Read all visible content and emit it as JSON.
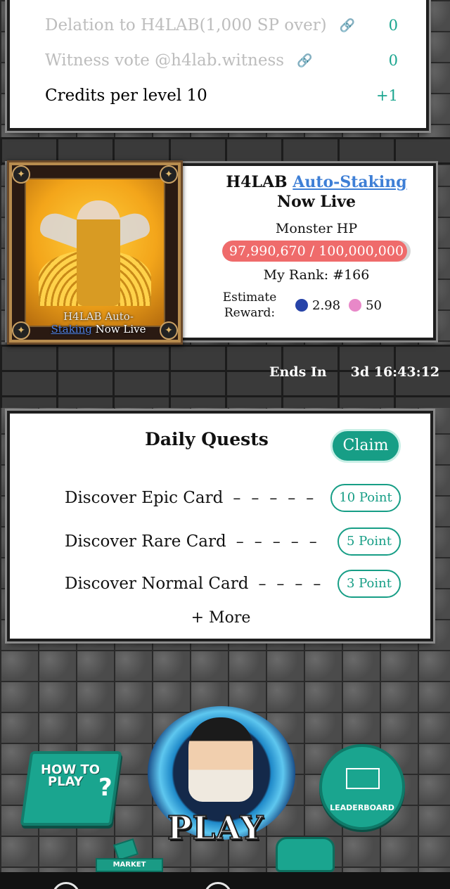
{
  "credits": {
    "rows": [
      {
        "label": "Delation to H4LAB(1,000 SP over)",
        "link_icon": "link-icon",
        "value": "0",
        "dim": true
      },
      {
        "label": "Witness vote @h4lab.witness",
        "link_icon": "link-icon",
        "value": "0",
        "dim": true
      },
      {
        "label": "Credits per level 10",
        "value": "+1",
        "dim": false
      }
    ]
  },
  "staking": {
    "card_caption_line1": "H4LAB Auto-",
    "card_caption_link": "Staking",
    "card_caption_rest": " Now Live",
    "title_prefix": "H4LAB ",
    "title_link": "Auto-Staking",
    "subtitle": "Now Live",
    "monster_hp_label": "Monster HP",
    "hp_text": "97,990,670 / 100,000,000",
    "hp_current": 97990670,
    "hp_max": 100000000,
    "rank_label": "My Rank: #166",
    "reward_label_1": "Estimate",
    "reward_label_2": "Reward:",
    "reward_steem": "2.98",
    "reward_points": "50",
    "ends_label": "Ends In",
    "ends_value": "3d 16:43:12"
  },
  "quests": {
    "title": "Daily Quests",
    "claim_label": "Claim",
    "items": [
      {
        "label": "Discover Epic Card",
        "dashes": "– – – – –",
        "points": "10 Point"
      },
      {
        "label": "Discover Rare Card",
        "dashes": "– – – – –",
        "points": "5 Point"
      },
      {
        "label": "Discover Normal Card",
        "dashes": "– – – –",
        "points": "3 Point"
      }
    ],
    "more_label": "+ More"
  },
  "bottom": {
    "howto_label_1": "HOW TO",
    "howto_label_2": "PLAY",
    "play_label": "PLAY",
    "leaderboard_label": "LEADERBOARD",
    "market_label": "MARKET",
    "accent_color": "#1aa58f"
  }
}
